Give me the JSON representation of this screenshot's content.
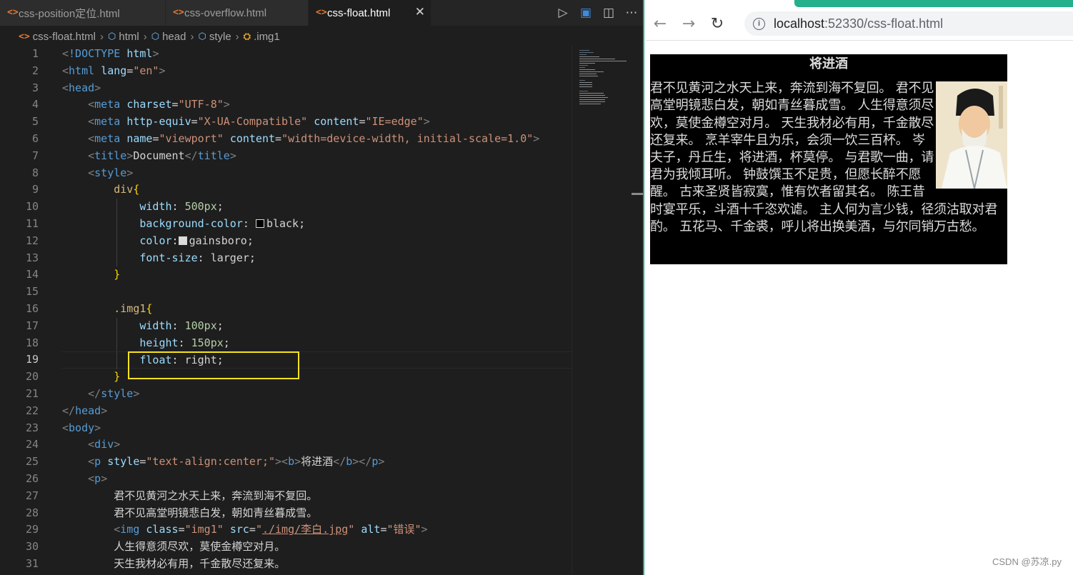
{
  "editor": {
    "tabs": [
      {
        "label": "css-position定位.html",
        "active": false
      },
      {
        "label": "css-overflow.html",
        "active": false
      },
      {
        "label": "css-float.html",
        "active": true
      }
    ],
    "tab_close_glyph": "✕",
    "breadcrumb": [
      "css-float.html",
      "html",
      "head",
      "style",
      ".img1"
    ],
    "active_line": 19,
    "line_numbers": [
      "1",
      "2",
      "3",
      "4",
      "5",
      "6",
      "7",
      "8",
      "9",
      "10",
      "11",
      "12",
      "13",
      "14",
      "15",
      "16",
      "17",
      "18",
      "19",
      "20",
      "21",
      "22",
      "23",
      "24",
      "25",
      "26",
      "27",
      "28",
      "29",
      "30",
      "31"
    ],
    "code": {
      "l1_doctype": "!DOCTYPE",
      "l1_html": "html",
      "l2_html": "html",
      "l2_attr": "lang",
      "l2_val": "\"en\"",
      "l3_head": "head",
      "l4_meta": "meta",
      "l4_attr": "charset",
      "l4_val": "\"UTF-8\"",
      "l5_meta": "meta",
      "l5_attr1": "http-equiv",
      "l5_val1": "\"X-UA-Compatible\"",
      "l5_attr2": "content",
      "l5_val2": "\"IE=edge\"",
      "l6_meta": "meta",
      "l6_attr1": "name",
      "l6_val1": "\"viewport\"",
      "l6_attr2": "content",
      "l6_val2": "\"width=device-width, initial-scale=1.0\"",
      "l7_title": "title",
      "l7_text": "Document",
      "l8_style": "style",
      "l9_sel": "div",
      "l10_prop": "width",
      "l10_val": "500px",
      "l11_prop": "background-color",
      "l11_val": "black",
      "l12_prop": "color",
      "l12_val": "gainsboro",
      "l13_prop": "font-size",
      "l13_val": "larger",
      "l16_sel": ".img1",
      "l17_prop": "width",
      "l17_val": "100px",
      "l18_prop": "height",
      "l18_val": "150px",
      "l19_prop": "float",
      "l19_val": "right",
      "l21_style": "style",
      "l22_head": "head",
      "l23_body": "body",
      "l24_div": "div",
      "l25_p": "p",
      "l25_attr": "style",
      "l25_val": "\"text-align:center;\"",
      "l25_b": "b",
      "l25_text": "将进酒",
      "l26_p": "p",
      "l27_text": "君不见黄河之水天上来，奔流到海不复回。",
      "l28_text": "君不见高堂明镜悲白发，朝如青丝暮成雪。",
      "l29_img": "img",
      "l29_attr1": "class",
      "l29_val1": "\"img1\"",
      "l29_attr2": "src",
      "l29_val2": "./img/李白.jpg",
      "l29_attr3": "alt",
      "l29_val3": "\"错误\"",
      "l30_text": "人生得意须尽欢，莫使金樽空对月。",
      "l31_text": "天生我材必有用，千金散尽还复来。"
    },
    "colors": {
      "swatch_black": "#000000",
      "swatch_gainsboro": "#dcdcdc",
      "highlight_box": "#f5e31b"
    }
  },
  "browser": {
    "url_host": "localhost",
    "url_rest": ":52330/css-float.html",
    "poem_title": "将进酒",
    "poem_text": "君不见黄河之水天上来，奔流到海不复回。 君不见高堂明镜悲白发，朝如青丝暮成雪。 人生得意须尽欢，莫使金樽空对月。 天生我材必有用，千金散尽还复来。 烹羊宰牛且为乐，会须一饮三百杯。 岑夫子，丹丘生，将进酒，杯莫停。 与君歌一曲，请君为我倾耳听。 钟鼓馔玉不足贵，但愿长醉不愿醒。 古来圣贤皆寂寞，惟有饮者留其名。 陈王昔时宴平乐，斗酒十千恣欢谑。 主人何为言少钱，径须沽取对君酌。 五花马、千金裘，呼儿将出换美酒，与尔同销万古愁。",
    "watermark": "CSDN @苏凉.py"
  }
}
